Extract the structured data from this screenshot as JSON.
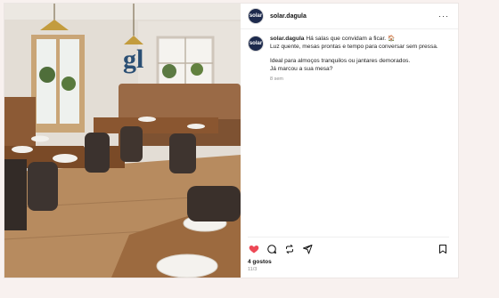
{
  "post": {
    "username": "solar.dagula",
    "avatar_text": "solar",
    "caption_line1": "Há salas que convidam a ficar. 🏠",
    "caption_line2": "Luz quente, mesas prontas e tempo para conversar sem pressa.",
    "caption_line3": "Ideal para almoços tranquilos ou jantares demorados.",
    "caption_line4": "Já marcou a sua mesa?",
    "time_ago": "8 sem",
    "likes": "4 gostos",
    "date": "11/3",
    "more_label": "···"
  },
  "colors": {
    "heart": "#ed4956",
    "avatar_bg": "#1d2a4d",
    "page_bg": "#f8f1ef"
  },
  "icons": [
    "heart-icon",
    "comment-icon",
    "repost-icon",
    "share-icon",
    "bookmark-icon",
    "more-icon"
  ]
}
